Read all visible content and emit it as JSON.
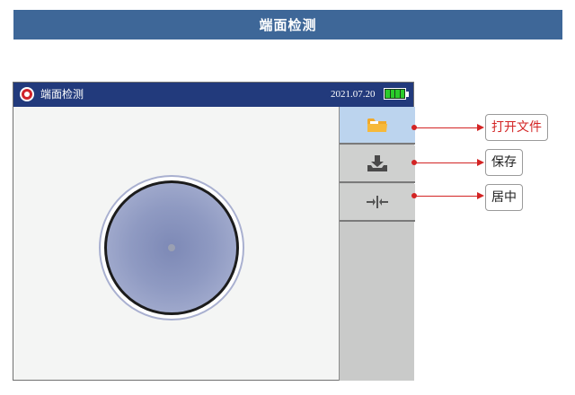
{
  "page_title": "端面检测",
  "app": {
    "title": "端面检测",
    "date": "2021.07.20",
    "battery_level": 1.0
  },
  "sidebar": {
    "buttons": [
      {
        "id": "open-file",
        "icon": "folder-icon"
      },
      {
        "id": "save",
        "icon": "download-tray-icon"
      },
      {
        "id": "center",
        "icon": "center-arrows-icon"
      }
    ]
  },
  "callouts": {
    "open_file": "打开文件",
    "save": "保存",
    "center": "居中"
  },
  "colors": {
    "banner": "#3e6798",
    "titlebar": "#223a7c",
    "open_file_text": "#d32424",
    "folder": "#f0a92b",
    "leader": "#d32424"
  }
}
